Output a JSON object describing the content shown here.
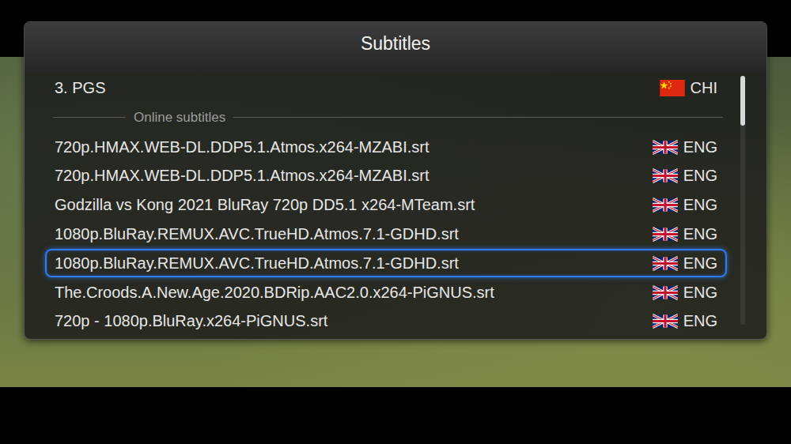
{
  "window": {
    "title": "Subtitles"
  },
  "embedded_subtitles": [
    {
      "label": "3. PGS",
      "language": "CHI",
      "selected": false
    }
  ],
  "online_section": {
    "label": "Online subtitles"
  },
  "online_subtitles": [
    {
      "label": "720p.HMAX.WEB-DL.DDP5.1.Atmos.x264-MZABI.srt",
      "language": "ENG",
      "selected": false
    },
    {
      "label": "720p.HMAX.WEB-DL.DDP5.1.Atmos.x264-MZABI.srt",
      "language": "ENG",
      "selected": false
    },
    {
      "label": "Godzilla vs Kong 2021 BluRay 720p DD5.1 x264-MTeam.srt",
      "language": "ENG",
      "selected": false
    },
    {
      "label": "1080p.BluRay.REMUX.AVC.TrueHD.Atmos.7.1-GDHD.srt",
      "language": "ENG",
      "selected": false
    },
    {
      "label": "1080p.BluRay.REMUX.AVC.TrueHD.Atmos.7.1-GDHD.srt",
      "language": "ENG",
      "selected": true
    },
    {
      "label": "The.Croods.A.New.Age.2020.BDRip.AAC2.0.x264-PiGNUS.srt",
      "language": "ENG",
      "selected": false
    },
    {
      "label": "720p - 1080p.BluRay.x264-PiGNUS.srt",
      "language": "ENG",
      "selected": false
    }
  ],
  "scrollbar": {
    "level": 0.2
  }
}
